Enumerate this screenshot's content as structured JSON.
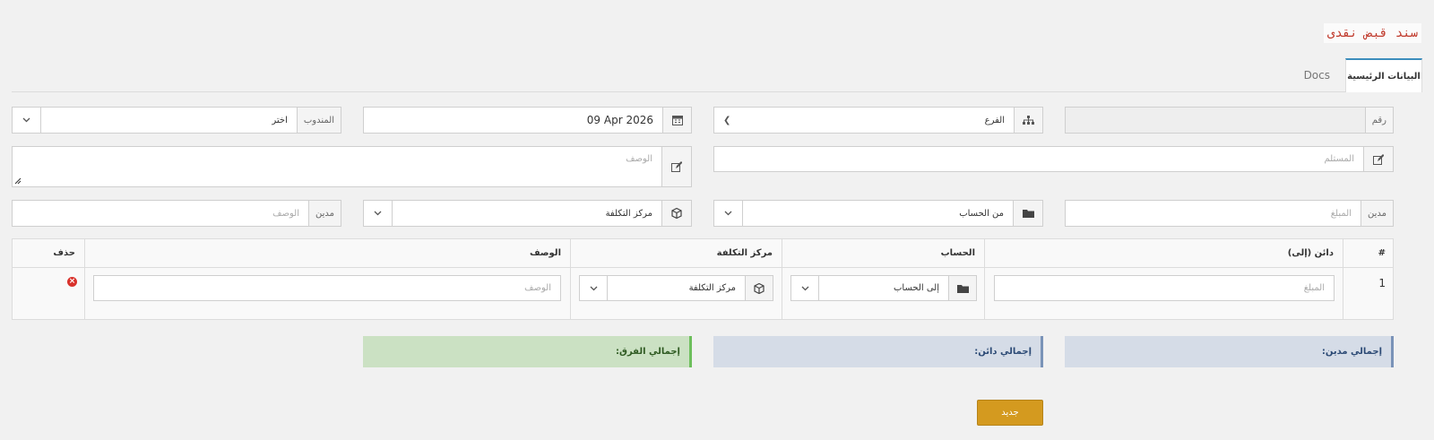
{
  "page": {
    "title": "سند قبض نقدى"
  },
  "tabs": [
    {
      "label": "البيانات الرئيسية",
      "active": true
    },
    {
      "label": "Docs",
      "active": false
    }
  ],
  "form": {
    "number_label": "رقم",
    "branch_label": "الفرع",
    "date_value": "09 Apr 2026",
    "rep_label": "المندوب",
    "rep_value": "اختر",
    "receiver_placeholder": "المستلم",
    "description_placeholder": "الوصف",
    "debit_label": "مدين",
    "amount_placeholder": "المبلغ",
    "from_account_label": "من الحساب",
    "cost_center_label": "مركز التكلفة",
    "debit_label_2": "مدين",
    "desc2_placeholder": "الوصف"
  },
  "table": {
    "headers": {
      "index": "#",
      "credit": "دائن (إلى)",
      "account": "الحساب",
      "cost_center": "مركز التكلفة",
      "description": "الوصف",
      "delete": "حذف"
    },
    "rows": [
      {
        "index": "1",
        "amount_placeholder": "المبلغ",
        "account_label": "إلى الحساب",
        "cost_center_label": "مركز التكلفة",
        "description_placeholder": "الوصف"
      }
    ]
  },
  "totals": {
    "debit": "إجمالي مدين:",
    "credit": "إجمالي دائن:",
    "difference": "إجمالي الفرق:"
  },
  "buttons": {
    "new": "جديد"
  },
  "colors": {
    "primary": "#3c8dbc",
    "danger": "#d9322c",
    "warning": "#d49a1f",
    "total_blue_bg": "#d5dce7",
    "total_green_bg": "#cbe1c3"
  }
}
